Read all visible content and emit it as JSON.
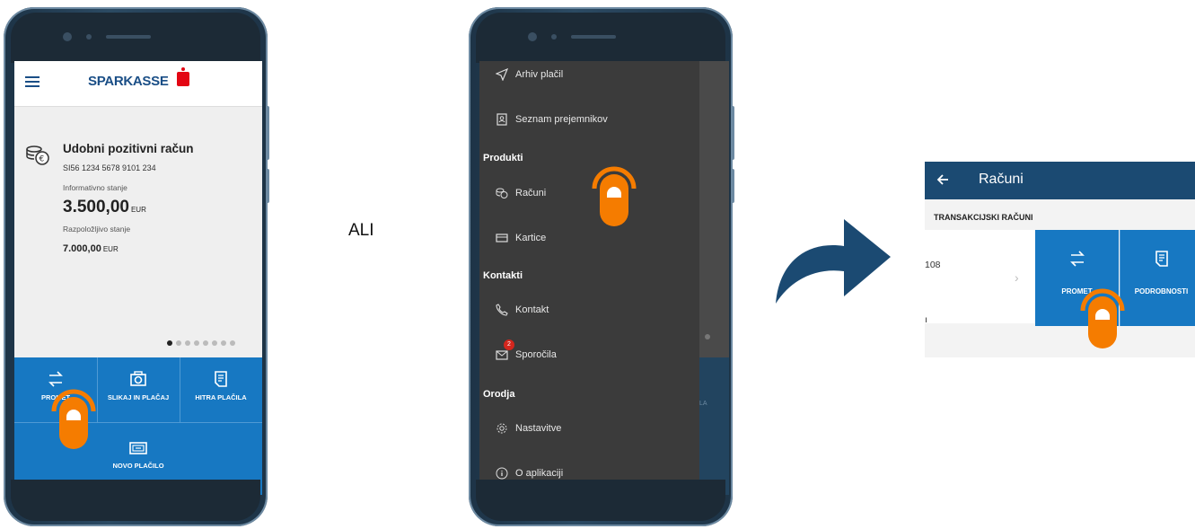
{
  "separator_text": "ALI",
  "phone1": {
    "logo": "SPARKASSE",
    "account": {
      "title": "Udobni pozitivni račun",
      "iban": "SI56 1234 5678 9101 234",
      "informative_label": "Informativno stanje",
      "informative_amount": "3.500,00",
      "available_label": "Razpoložljivo stanje",
      "available_amount": "7.000,00",
      "currency": "EUR"
    },
    "carousel": {
      "count": 8,
      "active_index": 0
    },
    "actions": [
      "PROMET",
      "SLIKAJ IN PLAČAJ",
      "HITRA PLAČILA",
      "NOVO PLAČILO"
    ]
  },
  "phone2": {
    "menu": {
      "items_top": [
        "Arhiv plačil",
        "Seznam prejemnikov"
      ],
      "section_products": "Produkti",
      "products": [
        "Računi",
        "Kartice"
      ],
      "section_contacts": "Kontakti",
      "contacts": [
        "Kontakt",
        "Sporočila"
      ],
      "messages_badge": "2",
      "section_tools": "Orodja",
      "tools": [
        "Nastavitve",
        "O aplikaciji"
      ]
    },
    "behind_label": "ILA"
  },
  "result": {
    "title": "Računi",
    "section": "TRANSAKCIJSKI RAČUNI",
    "row_fragment_top": "ı",
    "row_fragment": "108",
    "tiles": [
      "PROMET",
      "PODROBNOSTI"
    ]
  },
  "colors": {
    "brand_blue": "#1778c2",
    "dark_blue": "#1b4a72",
    "touch_orange": "#f57c00",
    "drawer_bg": "#3b3b3b",
    "sparkasse_red": "#e30613"
  }
}
